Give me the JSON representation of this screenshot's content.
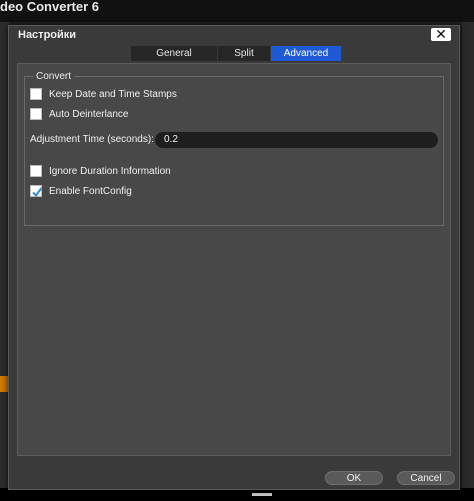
{
  "app": {
    "window_title": "deo Converter 6"
  },
  "dialog": {
    "title": "Настройки",
    "close_label": "✕",
    "tabs": [
      {
        "label": "General",
        "active": false
      },
      {
        "label": "Split",
        "active": false
      },
      {
        "label": "Advanced",
        "active": true
      }
    ],
    "group": {
      "title": "Convert",
      "options": [
        {
          "label": "Keep Date and Time Stamps",
          "checked": false
        },
        {
          "label": "Auto Deinterlance",
          "checked": false
        },
        {
          "label": "Ignore Duration Information",
          "checked": false
        },
        {
          "label": "Enable FontConfig",
          "checked": true
        }
      ],
      "adjustment": {
        "label": "Adjustment Time (seconds):",
        "value": "0.2"
      }
    },
    "buttons": {
      "ok": "OK",
      "cancel": "Cancel"
    }
  },
  "colors": {
    "accent": "#1f5ad6",
    "dialog_bg": "#3a3a3a",
    "panel_bg": "#484848",
    "check_mark": "#2a8fd6"
  }
}
